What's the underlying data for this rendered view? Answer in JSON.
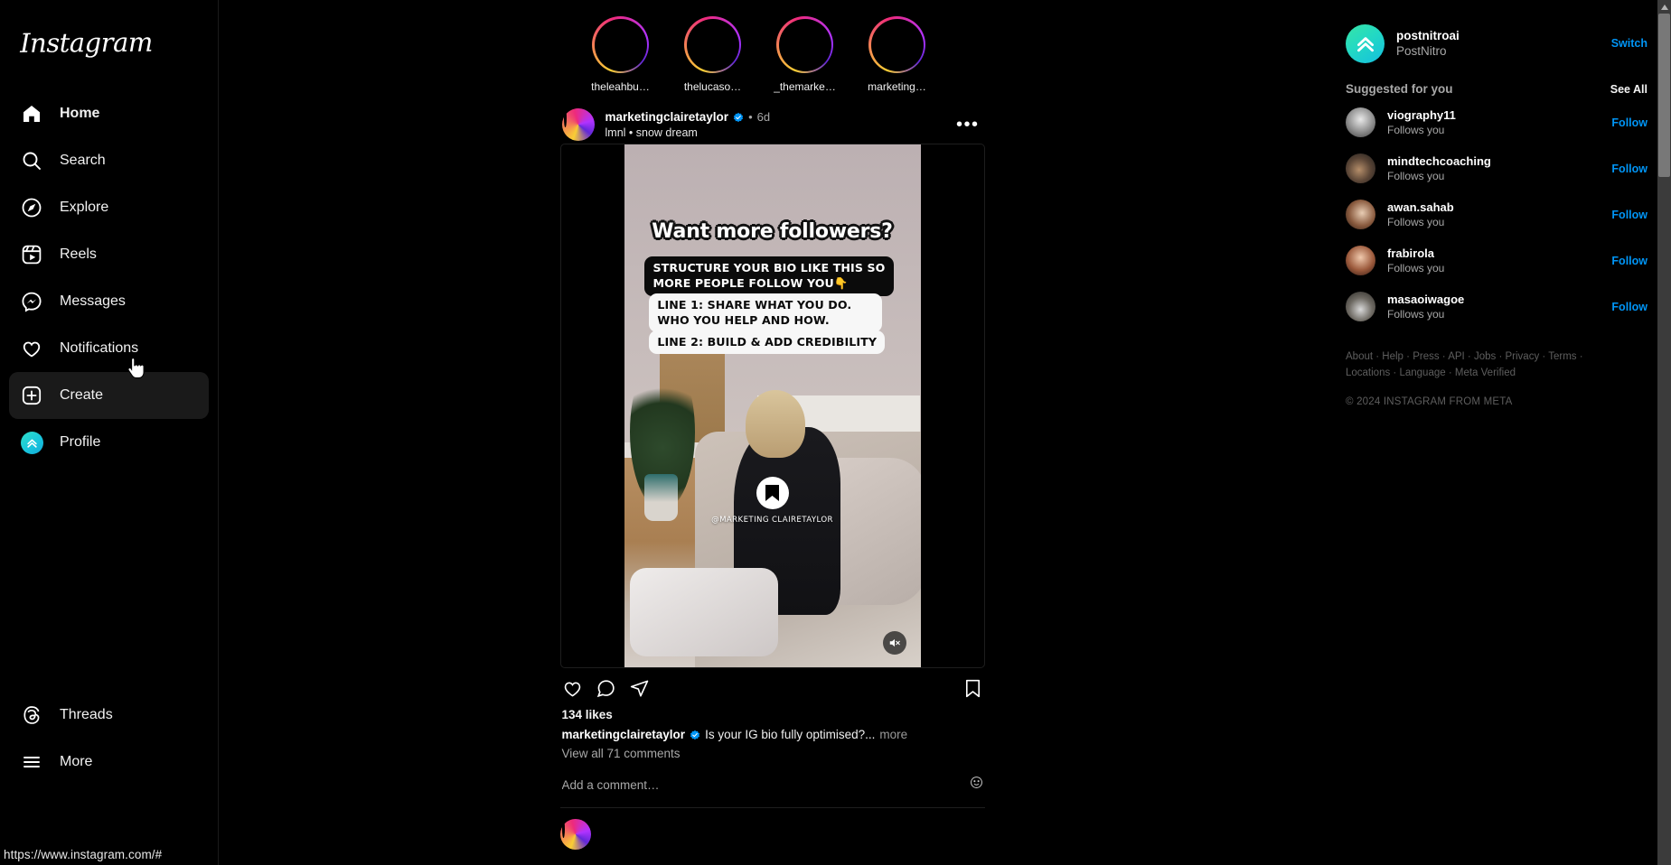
{
  "brand": {
    "name": "Instagram"
  },
  "sidebar": {
    "items": [
      {
        "label": "Home",
        "icon": "home-icon"
      },
      {
        "label": "Search",
        "icon": "search-icon"
      },
      {
        "label": "Explore",
        "icon": "compass-icon"
      },
      {
        "label": "Reels",
        "icon": "reels-icon"
      },
      {
        "label": "Messages",
        "icon": "messenger-icon"
      },
      {
        "label": "Notifications",
        "icon": "heart-icon"
      },
      {
        "label": "Create",
        "icon": "plus-square-icon"
      },
      {
        "label": "Profile",
        "icon": "profile-avatar-icon"
      }
    ],
    "bottom": [
      {
        "label": "Threads",
        "icon": "threads-icon"
      },
      {
        "label": "More",
        "icon": "hamburger-icon"
      }
    ]
  },
  "statusbar": {
    "url": "https://www.instagram.com/#"
  },
  "stories": [
    {
      "name": "theleahbu…"
    },
    {
      "name": "thelucaso…"
    },
    {
      "name": "_themarke…"
    },
    {
      "name": "marketing…"
    }
  ],
  "post": {
    "username": "marketingclairetaylor",
    "verified": true,
    "separator": "•",
    "time": "6d",
    "audio": "lmnl • snow dream",
    "more_label": "•••",
    "overlay": {
      "title": "Want more followers?",
      "dark_line": "STRUCTURE YOUR BIO LIKE THIS SO MORE PEOPLE FOLLOW YOU",
      "hand": "👇",
      "line1": "LINE 1: SHARE WHAT YOU DO. WHO YOU HELP AND HOW.",
      "line2": "LINE 2: BUILD & ADD CREDIBILITY"
    },
    "watermark": "@MARKETING CLAIRETAYLOR",
    "actions": {
      "like": "like-button",
      "comment": "comment-button",
      "share": "share-button",
      "save": "save-button"
    },
    "likes": "134 likes",
    "caption_text": "Is your IG bio fully optimised?...",
    "caption_more": "more",
    "comments_link": "View all 71 comments",
    "comment_placeholder": "Add a comment…"
  },
  "rail": {
    "account": {
      "username": "postnitroai",
      "display_name": "PostNitro",
      "switch_label": "Switch"
    },
    "suggested": {
      "title": "Suggested for you",
      "see_all": "See All",
      "follow_label": "Follow",
      "items": [
        {
          "username": "viography11",
          "sub": "Follows you"
        },
        {
          "username": "mindtechcoaching",
          "sub": "Follows you"
        },
        {
          "username": "awan.sahab",
          "sub": "Follows you"
        },
        {
          "username": "frabirola",
          "sub": "Follows you"
        },
        {
          "username": "masaoiwagoe",
          "sub": "Follows you"
        }
      ]
    },
    "footer": {
      "links_row1": [
        "About",
        "Help",
        "Press",
        "API",
        "Jobs",
        "Privacy",
        "Terms"
      ],
      "links_row2": [
        "Locations",
        "Language",
        "Meta Verified"
      ],
      "copyright": "© 2024 INSTAGRAM FROM META"
    }
  },
  "colors": {
    "accent_blue": "#0095f6",
    "background": "#000000",
    "text_secondary": "#a8a8a8",
    "brand_teal": "#14bfe0"
  }
}
